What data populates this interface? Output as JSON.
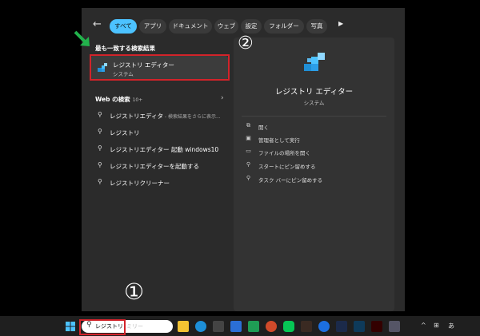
{
  "tabs": {
    "back_icon": "back-arrow-icon",
    "items": [
      "すべて",
      "アプリ",
      "ドキュメント",
      "ウェブ",
      "設定",
      "フォルダー",
      "写真"
    ],
    "more_icon": "play-icon"
  },
  "best_match": {
    "heading": "最も一致する検索結果",
    "name": "レジストリ エディター",
    "subtitle": "システム"
  },
  "web": {
    "heading": "Web の検索",
    "count": "10+",
    "suggestions": [
      {
        "text": "レジストリエディタ",
        "hint": " - 検索結果をさらに表示..."
      },
      {
        "text": "レジストリ",
        "hint": ""
      },
      {
        "text": "レジストリエディター 起動 windows10",
        "hint": ""
      },
      {
        "text": "レジストリエディターを起動する",
        "hint": ""
      },
      {
        "text": "レジストリクリーナー",
        "hint": ""
      }
    ]
  },
  "detail": {
    "title": "レジストリ エディター",
    "subtitle": "システム",
    "actions": [
      {
        "label": "開く",
        "icon": "open-icon"
      },
      {
        "label": "管理者として実行",
        "icon": "admin-shield-icon"
      },
      {
        "label": "ファイルの場所を開く",
        "icon": "folder-icon"
      },
      {
        "label": "スタートにピン留めする",
        "icon": "pin-icon"
      },
      {
        "label": "タスク バーにピン留めする",
        "icon": "pin-icon"
      }
    ]
  },
  "annotations": {
    "marker1": "①",
    "marker2": "②"
  },
  "taskbar": {
    "search_value": "レジストリ",
    "search_hint": "ミリー",
    "tray": [
      "^",
      "⊞",
      "あ"
    ]
  },
  "colors": {
    "accent": "#4cc2ff",
    "highlight_red": "#d2232a",
    "green_arrow": "#22b24c"
  }
}
